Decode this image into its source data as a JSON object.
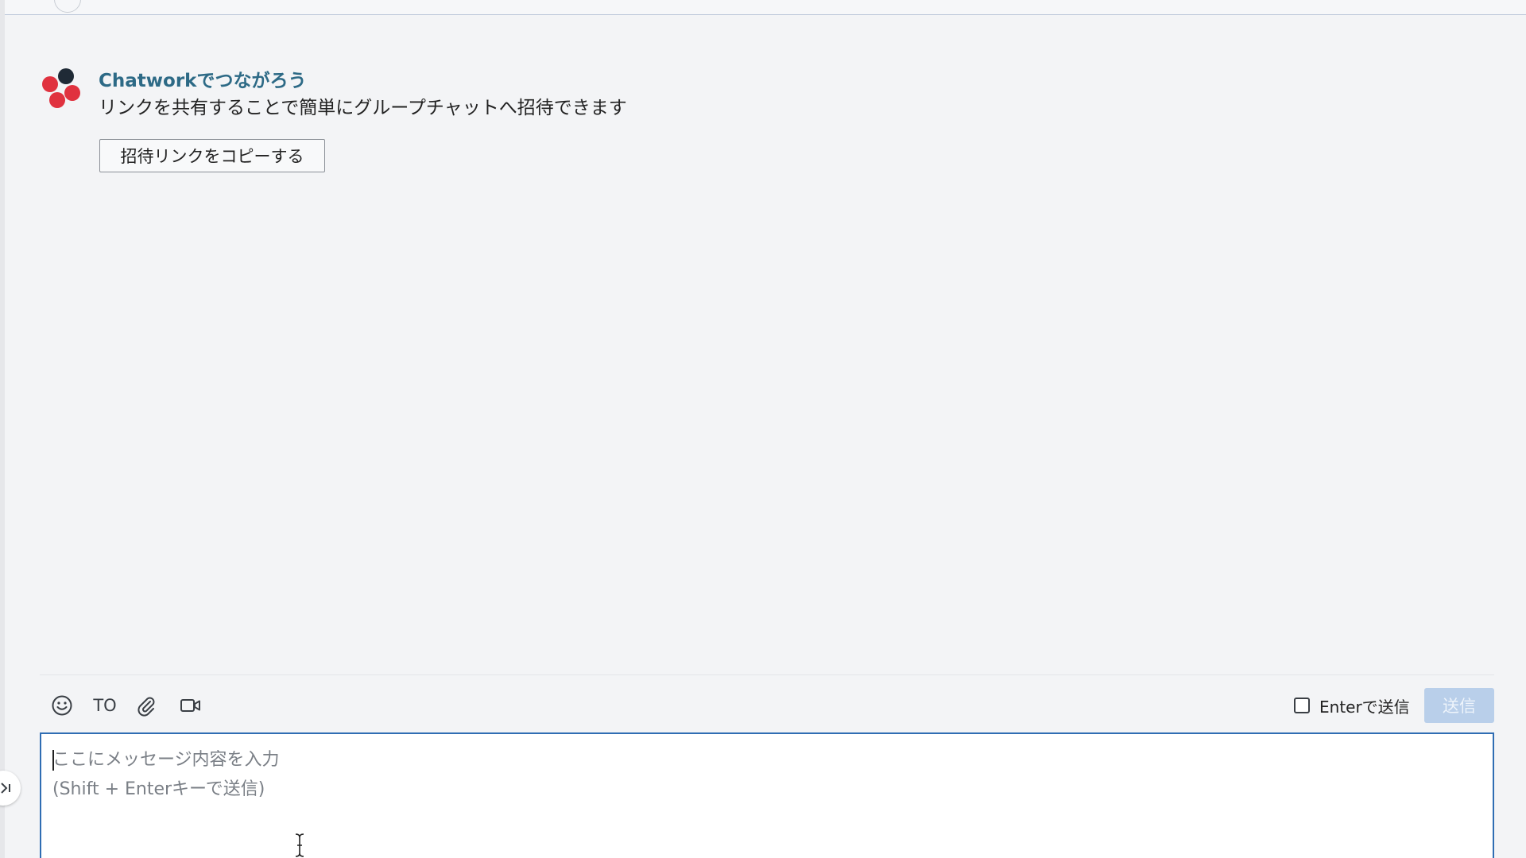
{
  "welcome": {
    "title": "Chatworkでつながろう",
    "description": "リンクを共有することで簡単にグループチャットへ招待できます",
    "invite_button_label": "招待リンクをコピーする"
  },
  "composer": {
    "toolbar": {
      "emoji_icon": "smiley-icon",
      "to_label": "TO",
      "attach_icon": "paperclip-icon",
      "video_icon": "video-call-icon"
    },
    "enter_send_label": "Enterで送信",
    "enter_send_checked": false,
    "send_button_label": "送信",
    "placeholder": "ここにメッセージ内容を入力\n(Shift + Enterキーで送信)"
  },
  "colors": {
    "accent": "#2f6db3",
    "title": "#2d6a86",
    "send_disabled": "#b9cfea",
    "logo_red": "#e0323f",
    "logo_dark": "#1f2a36"
  }
}
